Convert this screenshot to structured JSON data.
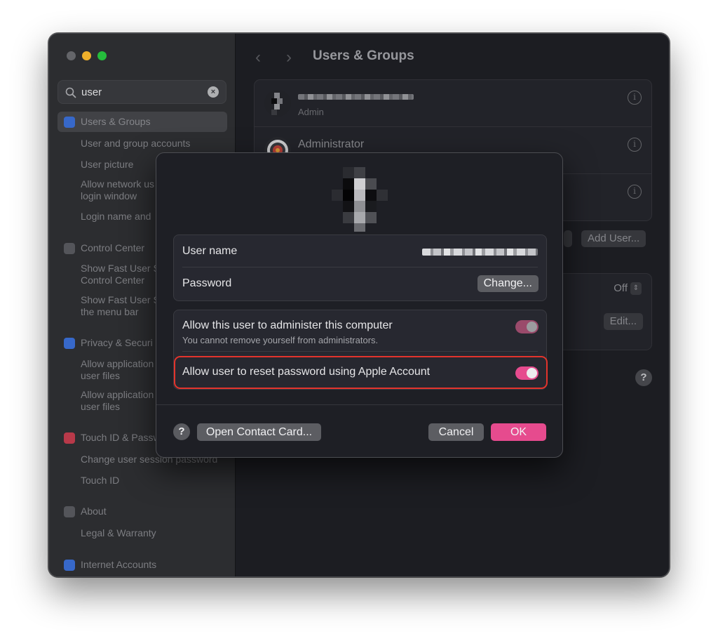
{
  "sidebar": {
    "search": {
      "value": "user"
    },
    "items": [
      {
        "label": "Users & Groups",
        "type": "section",
        "icon": "users-icon",
        "color": "#3b6fd6"
      },
      {
        "label": "User and group accounts",
        "type": "sub"
      },
      {
        "label": "User picture",
        "type": "sub"
      },
      {
        "label": "Allow network users to log in at login window",
        "type": "sub",
        "shown": "Allow network us\nlogin window"
      },
      {
        "label": "Login name and",
        "type": "sub"
      },
      {
        "label": "Control Center",
        "type": "section",
        "icon": "control-center-icon",
        "color": "#6a6b70"
      },
      {
        "label": "Show Fast User Switching in Control Center",
        "shown": "Show Fast User S\nControl Center",
        "type": "sub"
      },
      {
        "label": "Show Fast User Switching in the menu bar",
        "shown": "Show Fast User S\nthe menu bar",
        "type": "sub"
      },
      {
        "label": "Privacy & Security",
        "type": "section",
        "icon": "hand-icon",
        "color": "#3b6fd6"
      },
      {
        "label": "Allow applications to access user files",
        "shown": "Allow application\nuser files",
        "type": "sub"
      },
      {
        "label": "Allow applications to access user files",
        "shown": "Allow application\nuser files",
        "type": "sub"
      },
      {
        "label": "Touch ID & Password",
        "type": "section",
        "icon": "fingerprint-icon",
        "color": "#d6485a"
      },
      {
        "label": "Change user session password",
        "type": "sub"
      },
      {
        "label": "Touch ID",
        "type": "sub"
      },
      {
        "label": "About",
        "type": "section",
        "icon": "about-icon",
        "color": "#6a6b70"
      },
      {
        "label": "Legal & Warranty",
        "type": "sub"
      },
      {
        "label": "Internet Accounts",
        "type": "section",
        "icon": "at-icon",
        "color": "#3b6fd6"
      }
    ]
  },
  "sidebar_display": {
    "i0": "Users & Groups",
    "i1": "User and group accounts",
    "i2": "User picture",
    "i3a": "Allow network us",
    "i3b": "login window",
    "i4": "Login name and",
    "i5": "Control Center",
    "i6a": "Show Fast User S",
    "i6b": "Control Center",
    "i7a": "Show Fast User S",
    "i7b": "the menu bar",
    "i8": "Privacy & Securi",
    "i9a": "Allow application",
    "i9b": "user files",
    "i10a": "Allow application",
    "i10b": "user files",
    "i11": "Touch ID & Passw",
    "i12": "Change user session password",
    "i13": "Touch ID",
    "i14": "About",
    "i15": "Legal & Warranty",
    "i16": "Internet Accounts"
  },
  "content": {
    "title": "Users & Groups",
    "users": [
      {
        "role": "Admin"
      },
      {
        "name": "Administrator"
      }
    ],
    "add_user_label": "Add User...",
    "guest": {
      "select_value": "Off",
      "edit_label": "Edit..."
    }
  },
  "sheet": {
    "username_label": "User name",
    "password_label": "Password",
    "change_label": "Change...",
    "admin_label": "Allow this user to administer this computer",
    "admin_sub": "You cannot remove yourself from administrators.",
    "admin_toggle_on": true,
    "reset_label": "Allow user to reset password using Apple Account",
    "reset_toggle_on": true,
    "help_label": "?",
    "contact_label": "Open Contact Card...",
    "cancel_label": "Cancel",
    "ok_label": "OK"
  },
  "colors": {
    "accent": "#e64b8e",
    "highlight": "#e3342c"
  }
}
